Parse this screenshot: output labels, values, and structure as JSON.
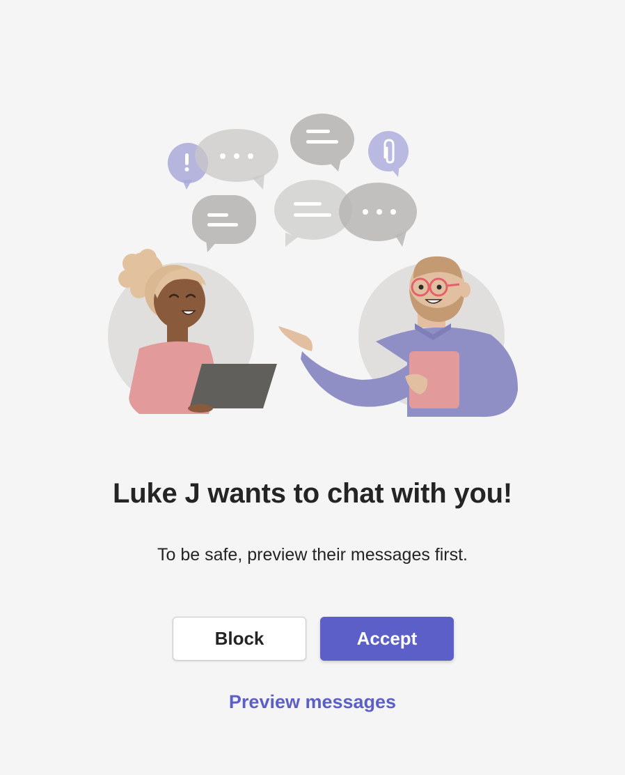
{
  "dialog": {
    "title": "Luke J wants to chat with you!",
    "subtitle": "To be safe, preview their messages first."
  },
  "actions": {
    "block_label": "Block",
    "accept_label": "Accept",
    "preview_label": "Preview messages"
  },
  "illustration": {
    "icons": [
      "exclamation-bubble-icon",
      "paperclip-bubble-icon",
      "ellipsis-bubble-icon",
      "text-lines-bubble-icon"
    ]
  },
  "colors": {
    "accent": "#5b5fc7",
    "background": "#f5f5f5",
    "text": "#242424",
    "bubble_gray": "#c8c8c8",
    "bubble_purple": "#a9a9d9"
  }
}
